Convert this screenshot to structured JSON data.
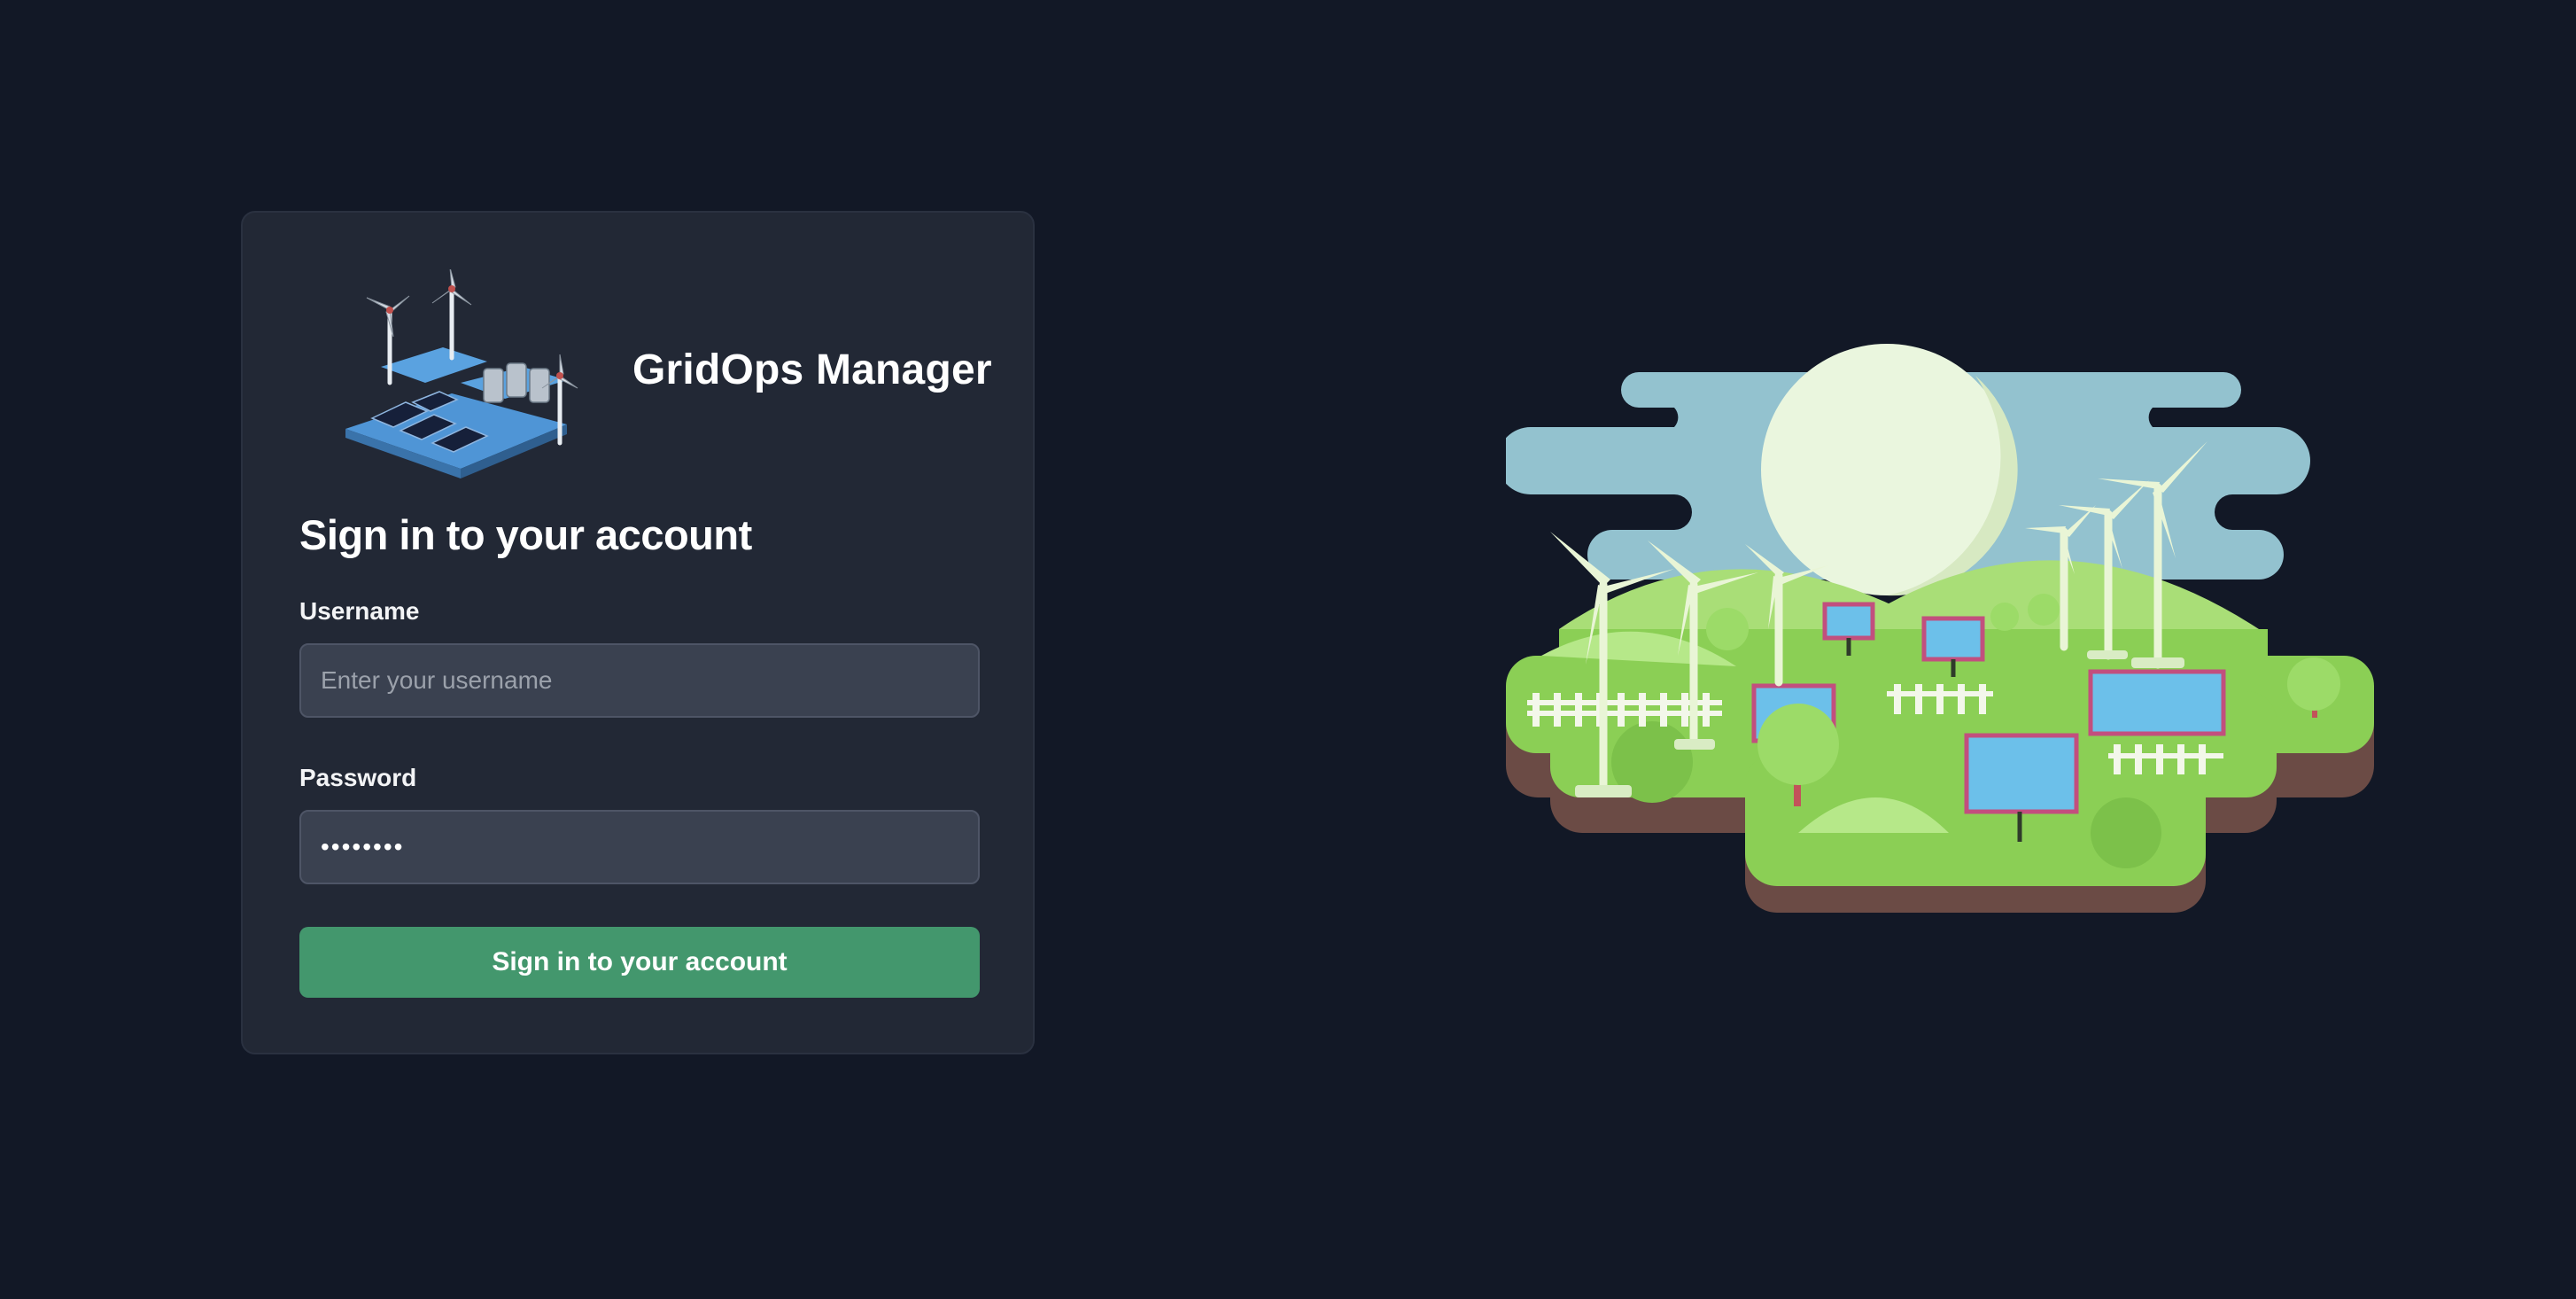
{
  "app": {
    "title": "GridOps Manager",
    "logo_icon": "wind-turbine-solar-panel-logo-icon"
  },
  "login": {
    "heading": "Sign in to your account",
    "username_label": "Username",
    "username_placeholder": "Enter your username",
    "username_value": "",
    "password_label": "Password",
    "password_value": "••••••••",
    "submit_label": "Sign in to your account"
  },
  "illustration": {
    "icon": "renewable-energy-landscape-illustration"
  },
  "colors": {
    "page_background": "#121826",
    "card_background": "#222835",
    "input_background": "#3a4150",
    "button_accent": "#43976d"
  }
}
